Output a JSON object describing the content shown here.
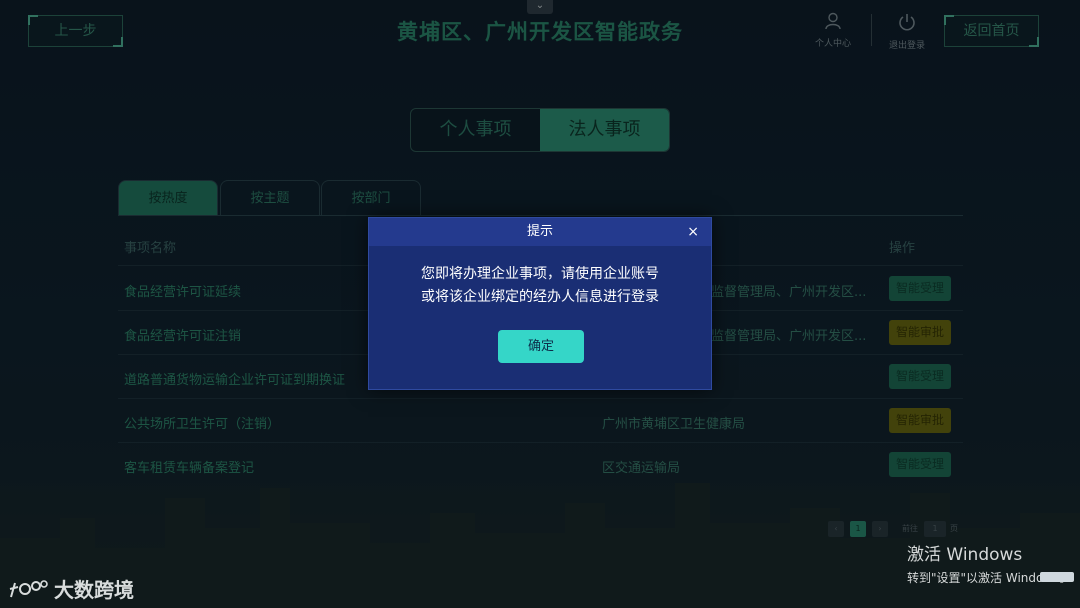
{
  "header": {
    "back_label": "上一步",
    "title": "黄埔区、广州开发区智能政务",
    "user_center_label": "个人中心",
    "logout_label": "退出登录",
    "home_label": "返回首页",
    "pull_tab_icon": "chevron-down-icon"
  },
  "segment": {
    "personal": "个人事项",
    "legal": "法人事项",
    "selected": "法人事项"
  },
  "category_tabs": [
    "按热度",
    "按主题",
    "按部门"
  ],
  "table": {
    "headers": {
      "name": "事项名称",
      "action": "操作"
    },
    "rows": [
      {
        "name": "食品经营许可证延续",
        "dept": "监督管理局、广州开发区...",
        "action": "智能受理",
        "action_type": "accept"
      },
      {
        "name": "食品经营许可证注销",
        "dept": "监督管理局、广州开发区...",
        "action": "智能审批",
        "action_type": "approve"
      },
      {
        "name": "道路普通货物运输企业许可证到期换证",
        "dept": "",
        "action": "智能受理",
        "action_type": "accept"
      },
      {
        "name": "公共场所卫生许可（注销）",
        "dept": "广州市黄埔区卫生健康局",
        "action": "智能审批",
        "action_type": "approve"
      },
      {
        "name": "客车租赁车辆备案登记",
        "dept": "区交通运输局",
        "action": "智能受理",
        "action_type": "accept"
      }
    ]
  },
  "pagination": {
    "prev": "‹",
    "current": "1",
    "next": "›",
    "goto_label": "前往",
    "page_input": "1",
    "page_unit": "页"
  },
  "modal": {
    "title": "提示",
    "close": "×",
    "message_line1": "您即将办理企业事项，请使用企业账号",
    "message_line2": "或将该企业绑定的经办人信息进行登录",
    "confirm": "确定"
  },
  "watermark": {
    "text": "大数跨境"
  },
  "activation": {
    "line1": "激活 Windows",
    "line2": "转到\"设置\"以激活 Windows。"
  },
  "colors": {
    "modal_bg": "#1a2e74",
    "confirm_bg": "#35d6c8",
    "accept_bg": "#1f6f58",
    "approve_bg": "#6b6b12"
  }
}
